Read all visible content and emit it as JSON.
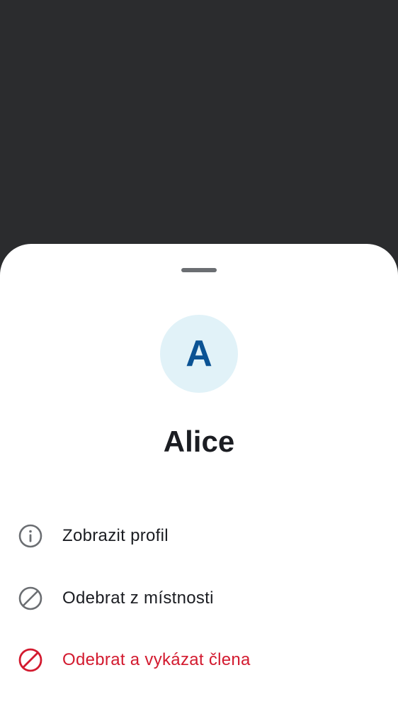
{
  "sheet": {
    "avatar": {
      "initial": "A",
      "background_color": "#e1f2f8",
      "text_color": "#0b5394"
    },
    "name": "Alice",
    "actions": [
      {
        "icon": "info-icon",
        "label": "Zobrazit profil",
        "color": "#1b1d22"
      },
      {
        "icon": "block-icon",
        "label": "Odebrat z místnosti",
        "color": "#1b1d22"
      },
      {
        "icon": "ban-icon",
        "label": "Odebrat a vykázat člena",
        "color": "#d31a2f"
      }
    ]
  },
  "colors": {
    "scrim": "#2b2c2e",
    "sheet_background": "#ffffff",
    "icon_neutral": "#6b6e72",
    "danger": "#d31a2f"
  }
}
